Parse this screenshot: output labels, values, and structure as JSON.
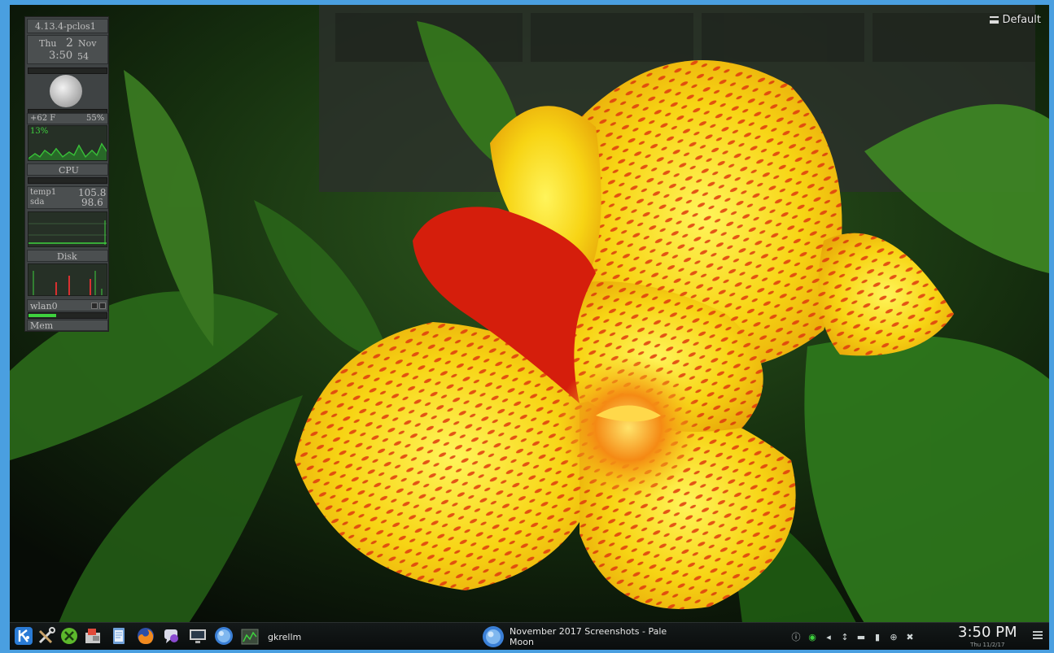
{
  "desktop": {
    "layout_label": "Default"
  },
  "gkrellm": {
    "hostname": "4.13.4-pclos1",
    "day": "Thu",
    "date_num": "2",
    "month": "Nov",
    "time_hm": "3:50",
    "time_s": "54",
    "cpu_temp_left": "+62 F",
    "cpu_temp_right": "55%",
    "cpu_percent": "13%",
    "cpu_label": "CPU",
    "sensors": [
      {
        "name": "temp1",
        "value": "105.8"
      },
      {
        "name": "sda",
        "value": "98.6"
      }
    ],
    "disk_label": "Disk",
    "net_label": "wlan0",
    "mem_label": "Mem",
    "mem_fill": 0.35
  },
  "taskbar": {
    "launchers": [
      {
        "icon": "kde-menu-icon"
      },
      {
        "icon": "tools-icon"
      },
      {
        "icon": "xfce-icon"
      },
      {
        "icon": "package-manager-icon"
      },
      {
        "icon": "notes-icon"
      },
      {
        "icon": "firefox-icon"
      },
      {
        "icon": "chat-icon"
      },
      {
        "icon": "monitor-icon"
      },
      {
        "icon": "palemoon-icon"
      },
      {
        "icon": "gkrellm-icon"
      }
    ],
    "tasks": [
      {
        "label": "gkrellm",
        "icon": "gkrellm-icon"
      },
      {
        "label_line1": "November 2017 Screenshots - Pale",
        "label_line2": "Moon",
        "icon": "palemoon-icon"
      }
    ],
    "tray": [
      {
        "icon": "info-icon",
        "glyph": "ⓘ"
      },
      {
        "icon": "wifi-icon",
        "glyph": "◉"
      },
      {
        "icon": "volume-icon",
        "glyph": "◂"
      },
      {
        "icon": "usb-icon",
        "glyph": "↕"
      },
      {
        "icon": "network-icon",
        "glyph": "▬"
      },
      {
        "icon": "battery-icon",
        "glyph": "▮"
      },
      {
        "icon": "bluetooth-icon",
        "glyph": "⊕"
      },
      {
        "icon": "tools-tray-icon",
        "glyph": "✖"
      }
    ],
    "clock_time": "3:50 PM",
    "clock_date": "Thu 11/2/17"
  },
  "colors": {
    "accent": "#4a9fe0",
    "gk_chart_line": "#3ed13e"
  }
}
